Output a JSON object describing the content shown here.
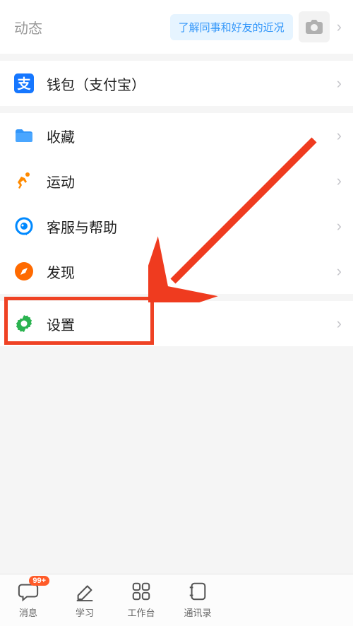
{
  "header": {
    "title": "动态",
    "tooltip": "了解同事和好友的近况"
  },
  "items": {
    "wallet": "钱包（支付宝）",
    "favorites": "收藏",
    "sports": "运动",
    "help": "客服与帮助",
    "discover": "发现",
    "settings": "设置"
  },
  "tabs": {
    "messages": {
      "label": "消息",
      "badge": "99+"
    },
    "study": {
      "label": "学习"
    },
    "workbench": {
      "label": "工作台"
    },
    "contacts": {
      "label": "通讯录"
    }
  }
}
